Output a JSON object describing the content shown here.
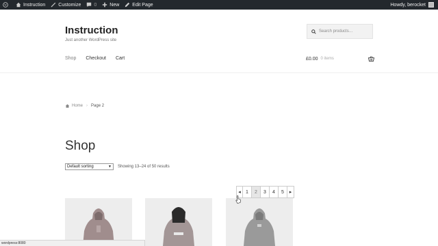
{
  "adminbar": {
    "site_name": "Instruction",
    "customize": "Customize",
    "comments_count": "0",
    "new": "New",
    "edit_page": "Edit Page",
    "howdy": "Howdy, berocket"
  },
  "header": {
    "title": "Instruction",
    "tagline": "Just another WordPress site",
    "search_placeholder": "Search products…"
  },
  "nav": {
    "items": [
      {
        "label": "Shop"
      },
      {
        "label": "Checkout"
      },
      {
        "label": "Cart"
      }
    ]
  },
  "cart": {
    "total": "£0.00",
    "count": "0 items"
  },
  "breadcrumb": {
    "home": "Home",
    "current": "Page 2"
  },
  "shop": {
    "title": "Shop",
    "sort_selected": "Default sorting",
    "result_count": "Showing 13–24 of 50 results"
  },
  "pagination": {
    "prev": "◂",
    "pages": [
      "1",
      "2",
      "3",
      "4",
      "5"
    ],
    "current": "2",
    "next": "▸"
  },
  "statusbar": {
    "text": "wordpress:8080"
  },
  "colors": {
    "adminbar_bg": "#23282d",
    "product_bg": "#ededed",
    "hoodie_pink": "#a08d8d",
    "hoodie_black": "#2b2b2b",
    "hoodie_gray": "#9a9a9a"
  }
}
